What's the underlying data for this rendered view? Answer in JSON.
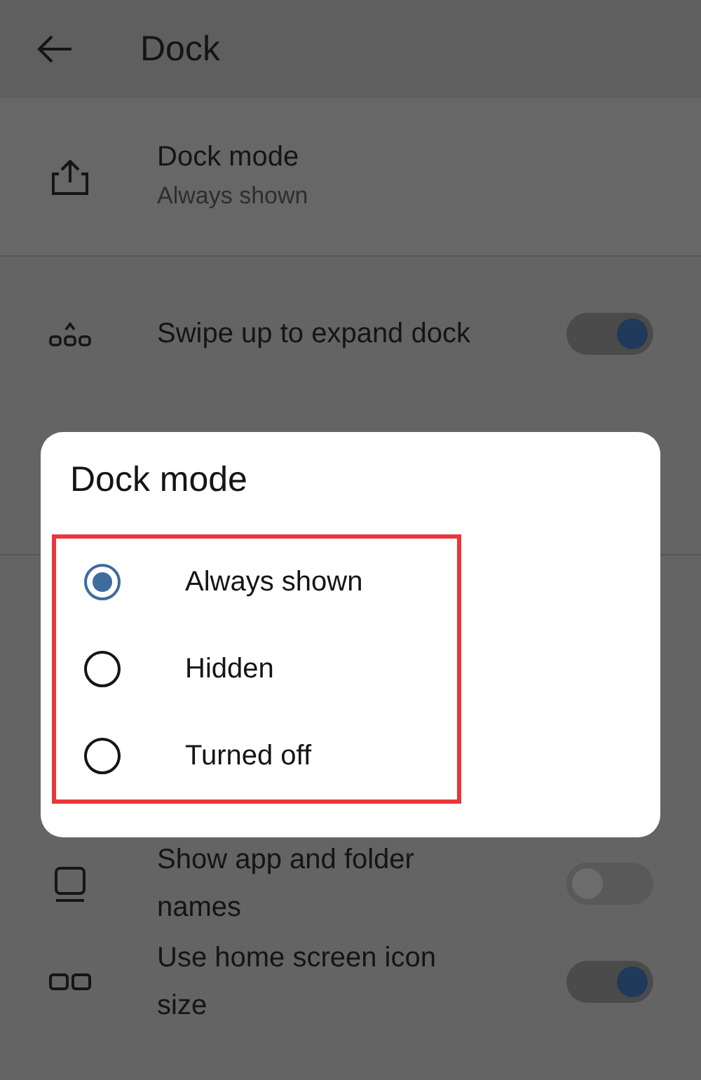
{
  "header": {
    "title": "Dock"
  },
  "sections": [
    {
      "items": [
        {
          "kind": "value",
          "title": "Dock mode",
          "value": "Always shown"
        }
      ]
    },
    {
      "items": [
        {
          "kind": "toggle",
          "title": "Swipe up to expand dock",
          "on": true
        }
      ]
    },
    {
      "items": [
        {
          "kind": "toggle",
          "title": "Show app and folder names",
          "on": false
        },
        {
          "kind": "toggle",
          "title": "Use home screen icon size",
          "on": true
        }
      ]
    }
  ],
  "dialog": {
    "title": "Dock mode",
    "options": [
      {
        "label": "Always shown",
        "selected": true
      },
      {
        "label": "Hidden",
        "selected": false
      },
      {
        "label": "Turned off",
        "selected": false
      }
    ]
  }
}
